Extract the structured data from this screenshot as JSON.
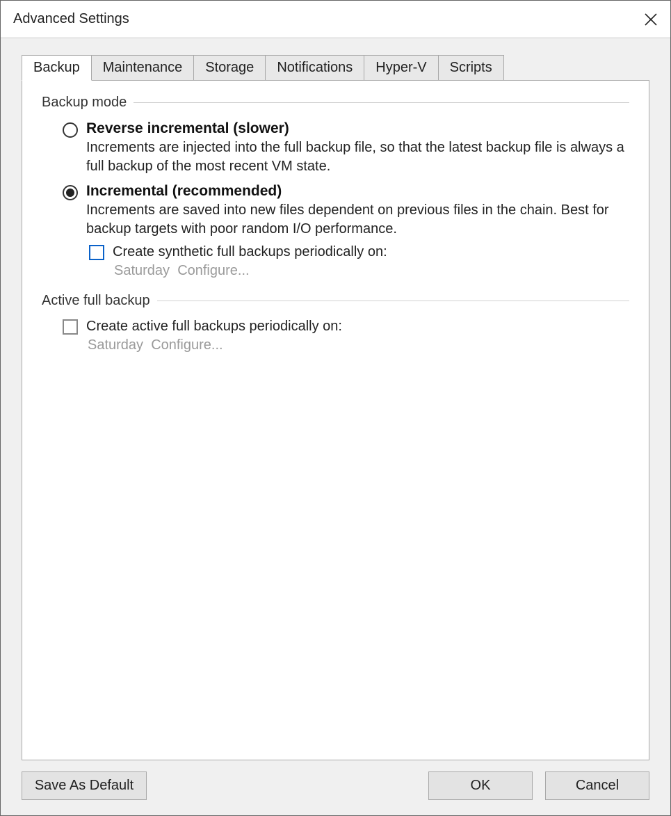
{
  "window": {
    "title": "Advanced Settings"
  },
  "tabs": {
    "t0": "Backup",
    "t1": "Maintenance",
    "t2": "Storage",
    "t3": "Notifications",
    "t4": "Hyper-V",
    "t5": "Scripts"
  },
  "backup_mode": {
    "group_title": "Backup mode",
    "reverse": {
      "title": "Reverse incremental (slower)",
      "desc": "Increments are injected into the full backup file, so that the latest backup file is always a full backup of the most recent VM state."
    },
    "incremental": {
      "title": "Incremental (recommended)",
      "desc": "Increments are saved into new files dependent on previous files in the chain. Best for backup targets with poor random I/O performance.",
      "synth_checkbox_label": "Create synthetic full backups periodically on:",
      "synth_day": "Saturday",
      "synth_configure": "Configure..."
    }
  },
  "active_full": {
    "group_title": "Active full backup",
    "checkbox_label": "Create active full backups periodically on:",
    "day": "Saturday",
    "configure": "Configure..."
  },
  "buttons": {
    "save_default": "Save As Default",
    "ok": "OK",
    "cancel": "Cancel"
  }
}
